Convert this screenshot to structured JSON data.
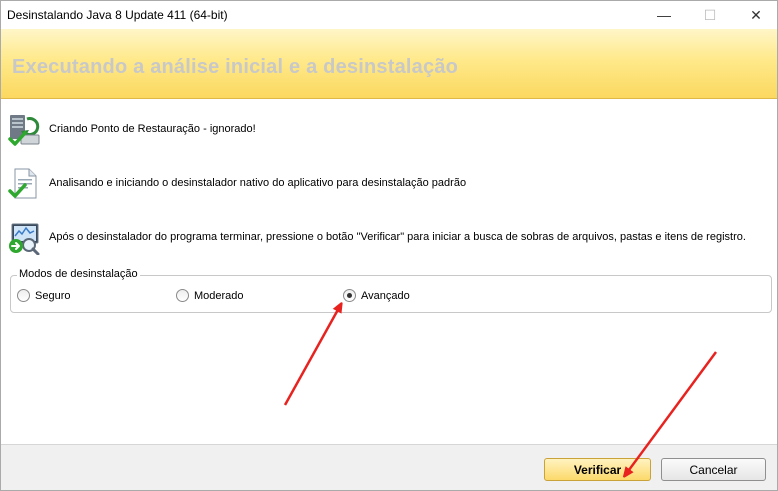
{
  "window": {
    "title": "Desinstalando Java 8 Update 411 (64-bit)",
    "minimize_glyph": "—",
    "maximize_glyph": "☐",
    "close_glyph": "✕"
  },
  "banner": {
    "title": "Executando a análise inicial e a desinstalação"
  },
  "steps": [
    {
      "icon": "restore-point-icon",
      "text": "Criando Ponto de Restauração - ignorado!"
    },
    {
      "icon": "document-check-icon",
      "text": "Analisando e iniciando o desinstalador nativo do aplicativo para desinstalação padrão"
    },
    {
      "icon": "monitor-search-icon",
      "text": "Após o desinstalador do programa terminar, pressione o botão \"Verificar\" para iniciar a busca de sobras de arquivos, pastas e itens de registro."
    }
  ],
  "modes": {
    "legend": "Modos de desinstalação",
    "options": [
      {
        "label": "Seguro",
        "checked": false
      },
      {
        "label": "Moderado",
        "checked": false
      },
      {
        "label": "Avançado",
        "checked": true
      }
    ]
  },
  "footer": {
    "verify_label": "Verificar",
    "cancel_label": "Cancelar"
  },
  "colors": {
    "banner_gradient_top": "#fff6c8",
    "banner_gradient_bottom": "#fbd860",
    "arrow": "#e8231f",
    "check_green": "#2ea82e"
  }
}
